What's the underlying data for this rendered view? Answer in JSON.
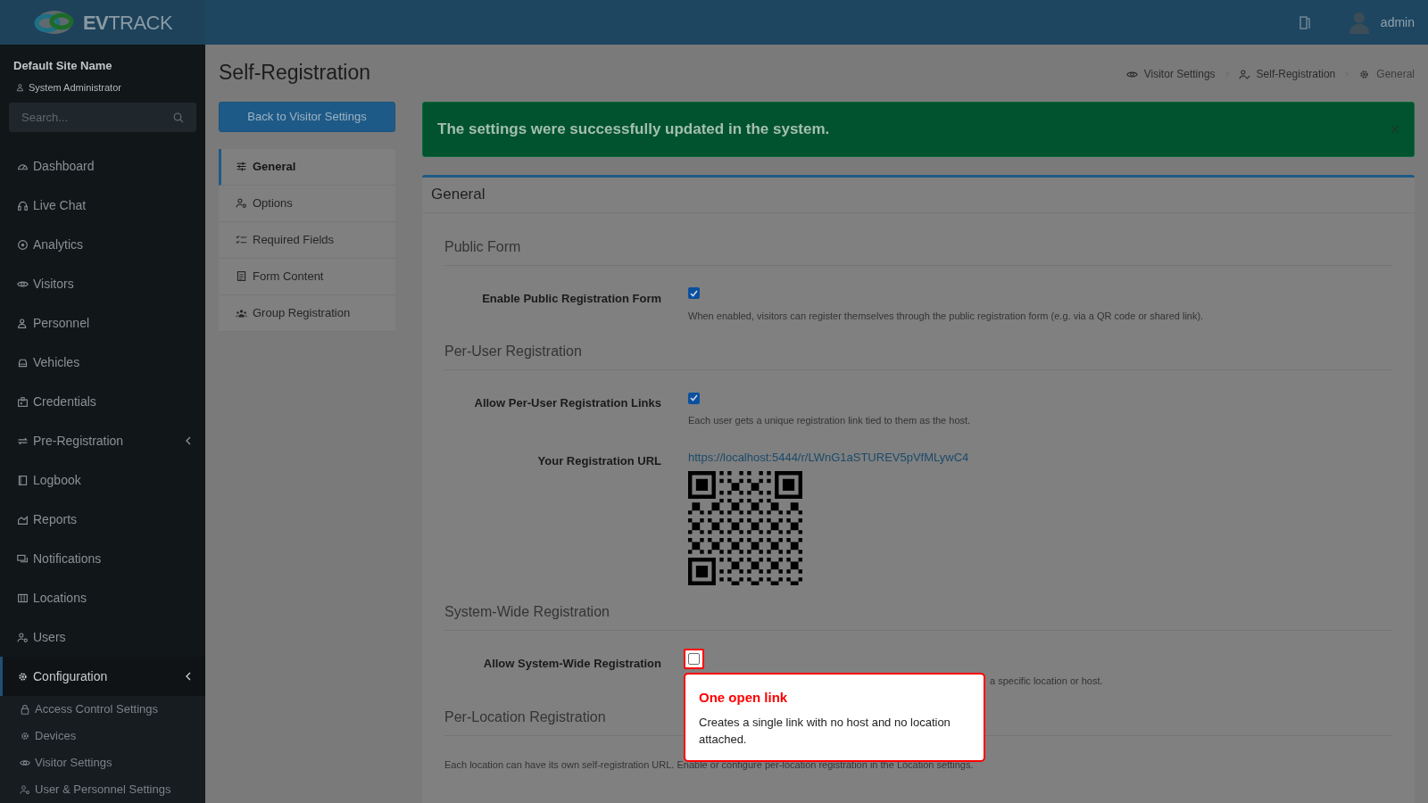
{
  "header": {
    "logo_text": "**EV**TRACK",
    "user": "admin"
  },
  "sidebar": {
    "site_name": "Default Site Name",
    "role": "System Administrator",
    "search": {
      "placeholder": "Search..."
    },
    "items": [
      {
        "label": "Dashboard",
        "selected": false,
        "has_submenu": false
      },
      {
        "label": "Live Chat",
        "selected": false,
        "has_submenu": false
      },
      {
        "label": "Analytics",
        "selected": false,
        "has_submenu": false
      },
      {
        "label": "Visitors",
        "selected": false,
        "has_submenu": false
      },
      {
        "label": "Personnel",
        "selected": false,
        "has_submenu": false
      },
      {
        "label": "Vehicles",
        "selected": false,
        "has_submenu": false
      },
      {
        "label": "Credentials",
        "selected": false,
        "has_submenu": false
      },
      {
        "label": "Pre-Registration",
        "selected": false,
        "has_submenu": true
      },
      {
        "label": "Logbook",
        "selected": false,
        "has_submenu": false
      },
      {
        "label": "Reports",
        "selected": false,
        "has_submenu": false
      },
      {
        "label": "Notifications",
        "selected": false,
        "has_submenu": false
      },
      {
        "label": "Locations",
        "selected": false,
        "has_submenu": false
      },
      {
        "label": "Users",
        "selected": false,
        "has_submenu": false
      },
      {
        "label": "Configuration",
        "selected": true,
        "has_submenu": true,
        "children": [
          {
            "label": "Access Control Settings",
            "selected": false
          },
          {
            "label": "Devices",
            "selected": false
          },
          {
            "label": "Visitor Settings",
            "selected": false
          },
          {
            "label": "User & Personnel Settings",
            "selected": false
          }
        ]
      }
    ]
  },
  "page_title": "Self-Registration",
  "breadcrumb": [
    {
      "label": "Visitor Settings"
    },
    {
      "label": "Self-Registration"
    },
    {
      "label": "General"
    }
  ],
  "back_button": "Back to Visitor Settings",
  "settings_menu": [
    {
      "label": "General",
      "selected": true
    },
    {
      "label": "Options",
      "selected": false
    },
    {
      "label": "Required Fields",
      "selected": false
    },
    {
      "label": "Form Content",
      "selected": false
    },
    {
      "label": "Group Registration",
      "selected": false
    }
  ],
  "alert": {
    "text": "The settings were successfully updated in the system."
  },
  "card_title": "General",
  "sections": [
    {
      "title": "Public Form",
      "rows": [
        {
          "kind": "checkbox",
          "label": "Enable Public Registration Form",
          "checked": true,
          "highlighted": false,
          "description": "When enabled, visitors can register themselves through the public registration form (e.g. via a QR code or shared link)."
        }
      ]
    },
    {
      "title": "Per-User Registration",
      "rows": [
        {
          "kind": "checkbox",
          "label": "Allow Per-User Registration Links",
          "checked": true,
          "highlighted": false,
          "description": "Each user gets a unique registration link tied to them as the host."
        },
        {
          "kind": "url",
          "label": "Your Registration URL",
          "url": "https://localhost:5444/r/LWnG1aSTUREV5pVfMLywC4"
        }
      ]
    },
    {
      "title": "System-Wide Registration",
      "rows": [
        {
          "kind": "checkbox",
          "label": "Allow System-Wide Registration",
          "checked": false,
          "highlighted": true,
          "description": "a specific location or host.",
          "popover": {
            "title": "One open link",
            "text": "Creates a single link with no host and no location attached."
          }
        }
      ]
    },
    {
      "title": "Per-Location Registration",
      "note": "Each location can have its own self-registration URL. Enable or configure per-location registration in the Location settings."
    }
  ]
}
